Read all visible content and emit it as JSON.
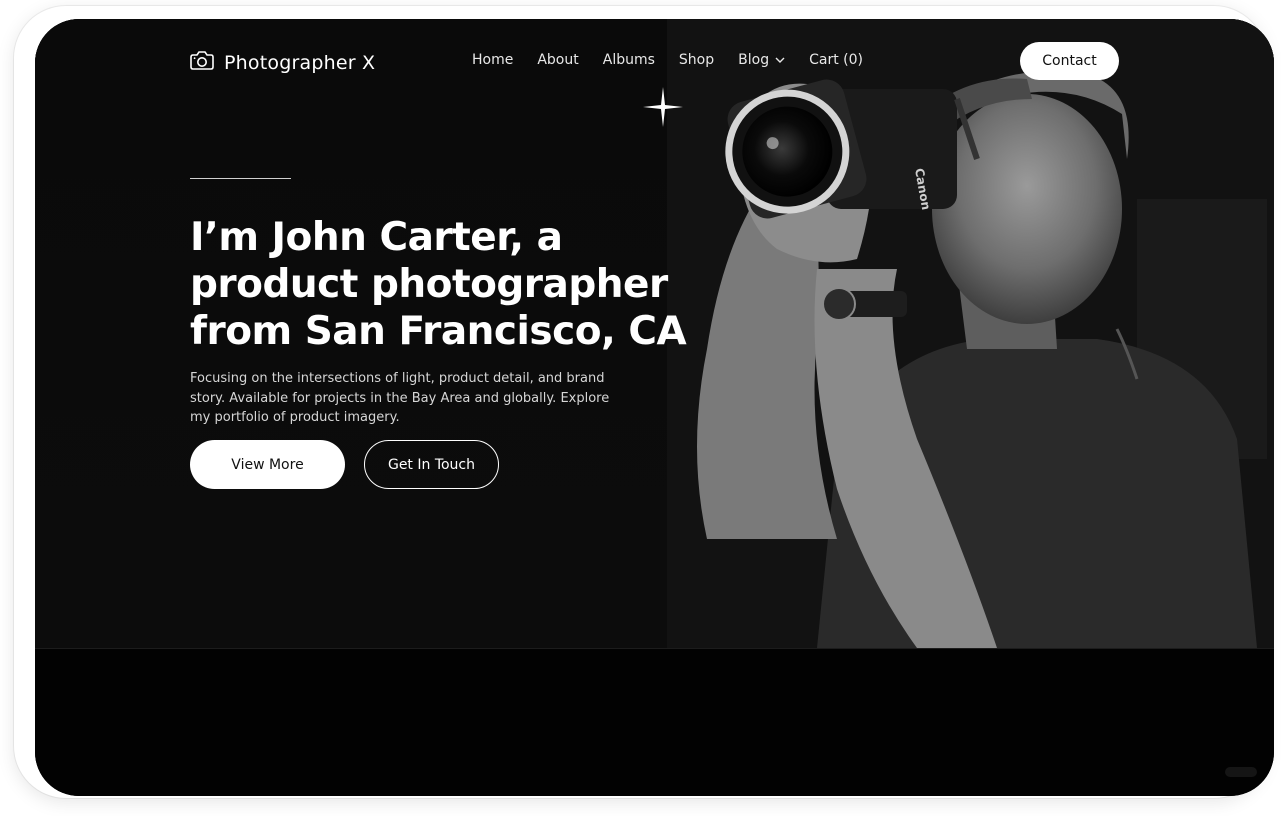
{
  "brand": {
    "name": "Photographer X",
    "icon": "camera-icon"
  },
  "nav": {
    "items": [
      {
        "label": "Home"
      },
      {
        "label": "About"
      },
      {
        "label": "Albums"
      },
      {
        "label": "Shop"
      },
      {
        "label": "Blog",
        "icon": "chevron-down-icon"
      },
      {
        "label": "Cart (0)"
      }
    ],
    "contact_label": "Contact"
  },
  "hero": {
    "headline_lines": [
      "I’m John Carter, a",
      "product photographer",
      "from San Francisco, CA"
    ],
    "subtext_lines": [
      "Focusing on the intersections of light, product detail, and brand",
      "story. Available for projects in the Bay Area and globally. Explore",
      "my portfolio of product imagery."
    ],
    "primary_button": "View More",
    "secondary_button": "Get In Touch",
    "camera_brand_text": "Canon"
  },
  "colors": {
    "background": "#0b0b0b",
    "text": "#ffffff",
    "button_bg": "#ffffff",
    "button_text": "#111111"
  }
}
